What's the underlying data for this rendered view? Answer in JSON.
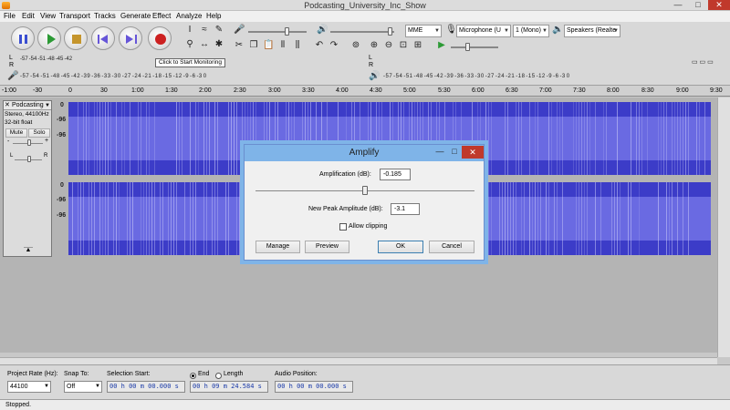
{
  "window": {
    "title": "Podcasting_University_Inc_Show",
    "controls": {
      "minimize": "—",
      "maximize": "□",
      "close": "✕"
    }
  },
  "menu": [
    "File",
    "Edit",
    "View",
    "Transport",
    "Tracks",
    "Generate",
    "Effect",
    "Analyze",
    "Help"
  ],
  "toolbar": {
    "transport": [
      "pause",
      "play",
      "stop",
      "skip-start",
      "skip-end",
      "record"
    ],
    "host": "MME",
    "input_device": "Microphone (U",
    "channels": "1 (Mono)",
    "output_device": "Speakers (Realte",
    "monitor_tooltip": "Click to Start Monitoring"
  },
  "meters": {
    "channel_l": "L",
    "channel_r": "R",
    "scale_top": [
      "-57",
      "-54",
      "-51",
      "-48",
      "-45",
      "-42"
    ],
    "scale_bottom": [
      "-57",
      "-54",
      "-51",
      "-48",
      "-45",
      "-42",
      "-39",
      "-36",
      "-33",
      "-30",
      "-27",
      "-24",
      "-21",
      "-18",
      "-15",
      "-12",
      "-9",
      "-6",
      "-3",
      "0"
    ],
    "scale_playback": [
      "-57",
      "-54",
      "-51",
      "-48",
      "-45",
      "-42",
      "-39",
      "-36",
      "-33",
      "-30",
      "-27",
      "-24",
      "-21",
      "-18",
      "-15",
      "-12",
      "-9",
      "-6",
      "-3",
      "0"
    ],
    "scale_left_bottom": [
      "-57",
      "-54",
      "-51",
      "-48",
      "-45",
      "-42",
      "-3",
      "-39",
      "-36",
      "-33",
      "-30",
      "-27",
      "-24",
      "-21",
      "-18",
      "-15",
      "-12",
      "-9",
      "-6",
      "-3",
      "0"
    ]
  },
  "timeline": [
    "-1:00",
    "-30",
    "0",
    "30",
    "1:00",
    "1:30",
    "2:00",
    "2:30",
    "3:00",
    "3:30",
    "4:00",
    "4:30",
    "5:00",
    "5:30",
    "6:00",
    "6:30",
    "7:00",
    "7:30",
    "8:00",
    "8:30",
    "9:00",
    "9:30"
  ],
  "track": {
    "name": "Podcasting",
    "info1": "Stereo, 44100Hz",
    "info2": "32-bit float",
    "mute": "Mute",
    "solo": "Solo",
    "gain_minus": "-",
    "gain_plus": "+",
    "pan_left": "L",
    "pan_right": "R",
    "close": "✕",
    "scale": [
      "0",
      "-96",
      "-96",
      "0",
      "-96",
      "-96"
    ]
  },
  "amplify_dialog": {
    "title": "Amplify",
    "amplification_label": "Amplification (dB):",
    "amplification_value": "-0.185",
    "peak_label": "New Peak Amplitude (dB):",
    "peak_value": "-3.1",
    "allow_clipping_label": "Allow clipping",
    "allow_clipping_checked": false,
    "amplification_slider_fraction": 0.5,
    "buttons": {
      "manage": "Manage",
      "preview": "Preview",
      "ok": "OK",
      "cancel": "Cancel"
    }
  },
  "selection_bar": {
    "project_rate_label": "Project Rate (Hz):",
    "project_rate": "44100",
    "snap_to_label": "Snap To:",
    "snap_to": "Off",
    "selection_start_label": "Selection Start:",
    "selection_start": "00 h 00 m 00.000 s",
    "end_label": "End",
    "length_label": "Length",
    "end_selected": true,
    "selection_end": "00 h 09 m 24.584 s",
    "audio_position_label": "Audio Position:",
    "audio_position": "00 h 00 m 00.000 s"
  },
  "status": "Stopped."
}
